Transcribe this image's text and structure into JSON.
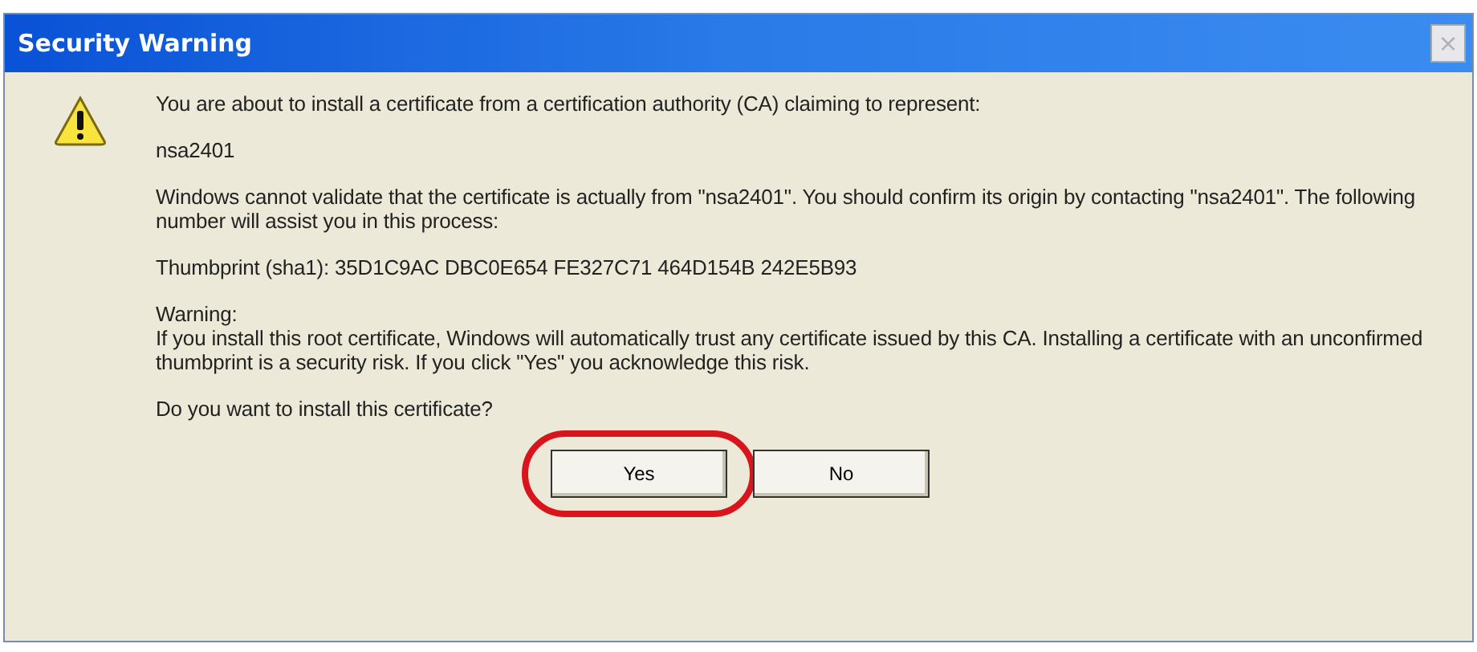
{
  "window": {
    "title": "Security Warning",
    "close": "×"
  },
  "paragraphs": [
    {
      "kind": "text",
      "text": "You are about to install a certificate from a certification authority (CA) claiming to represent:"
    },
    {
      "kind": "text",
      "text": "nsa2401"
    },
    {
      "kind": "text",
      "text": "Windows cannot validate that the certificate is actually from \"nsa2401\". You should confirm its origin by contacting \"nsa2401\". The following number will assist you in this process:"
    },
    {
      "kind": "text",
      "text": "Thumbprint (sha1): 35D1C9AC DBC0E654 FE327C71 464D154B 242E5B93"
    },
    {
      "kind": "warning",
      "heading": "Warning:",
      "text": "If you install this root certificate, Windows will automatically trust any certificate issued by this CA. Installing a certificate with an unconfirmed thumbprint is a security risk. If you click \"Yes\" you acknowledge this risk."
    },
    {
      "kind": "text",
      "text": "Do you want to install this certificate?"
    }
  ],
  "buttons": [
    {
      "label": "Yes",
      "highlighted": true
    },
    {
      "label": "No",
      "highlighted": false
    }
  ]
}
